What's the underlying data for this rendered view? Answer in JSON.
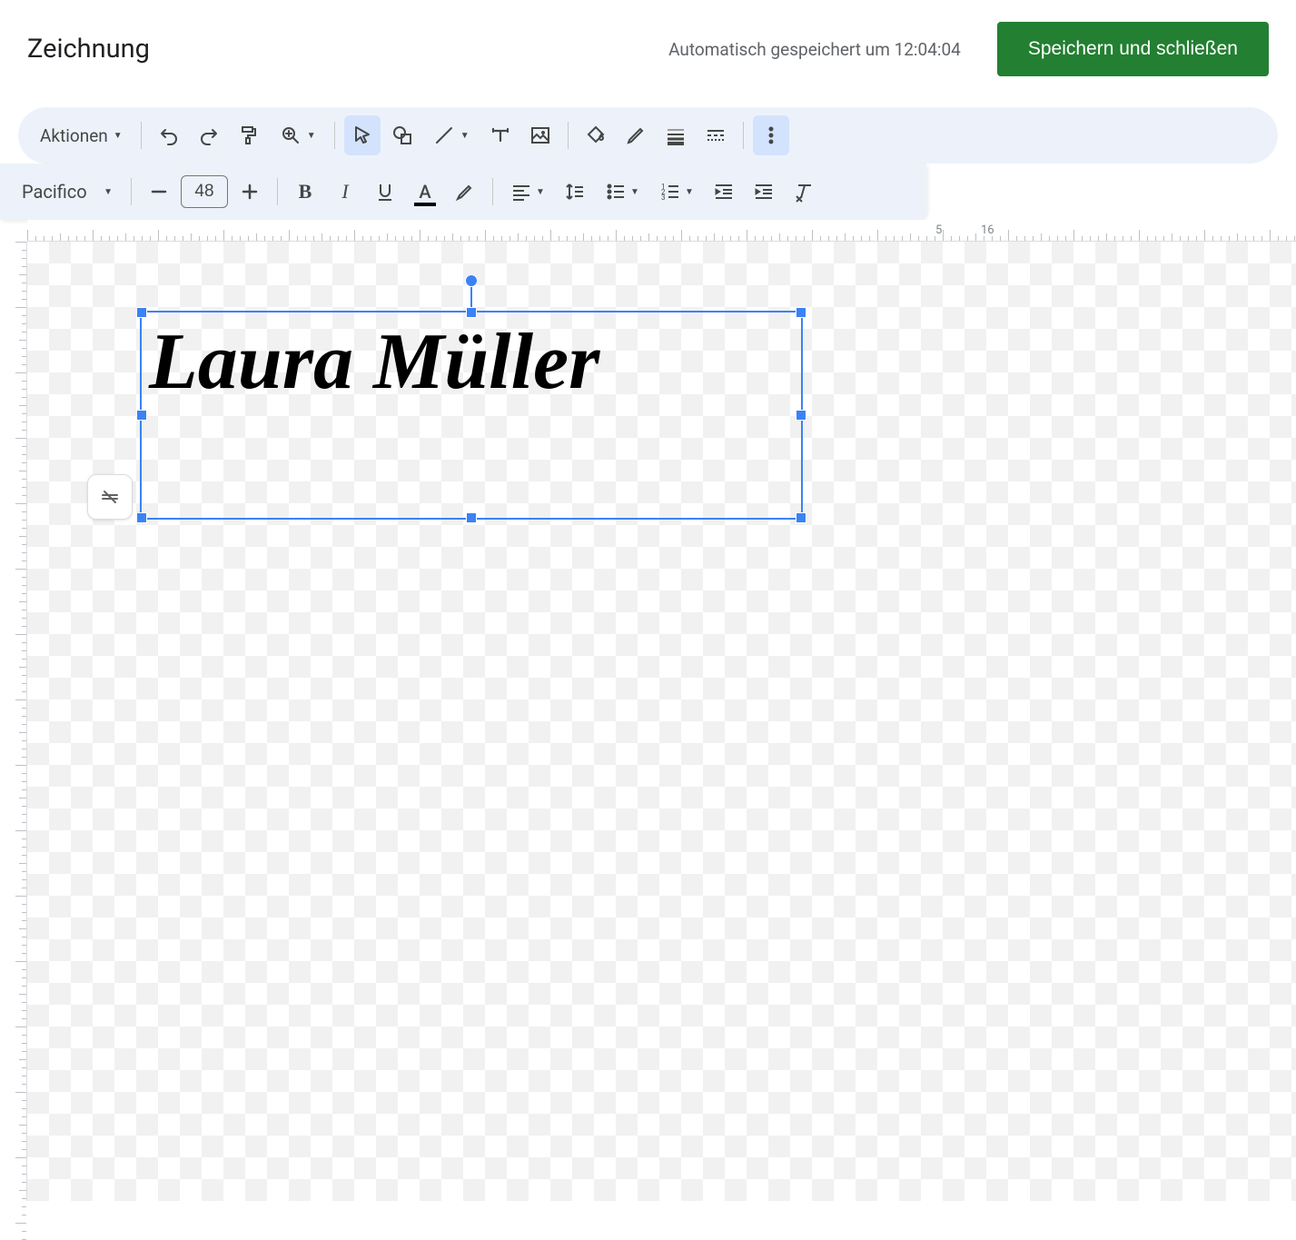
{
  "header": {
    "title": "Zeichnung",
    "autosave": "Automatisch gespeichert um 12:04:04",
    "save_close": "Speichern und schließen"
  },
  "toolbar": {
    "actions_label": "Aktionen"
  },
  "text_toolbar": {
    "font_name": "Pacifico",
    "font_size": "48"
  },
  "canvas": {
    "text_content": "Laura Müller"
  },
  "ruler": {
    "h_numbers": [
      "5",
      "16"
    ]
  }
}
